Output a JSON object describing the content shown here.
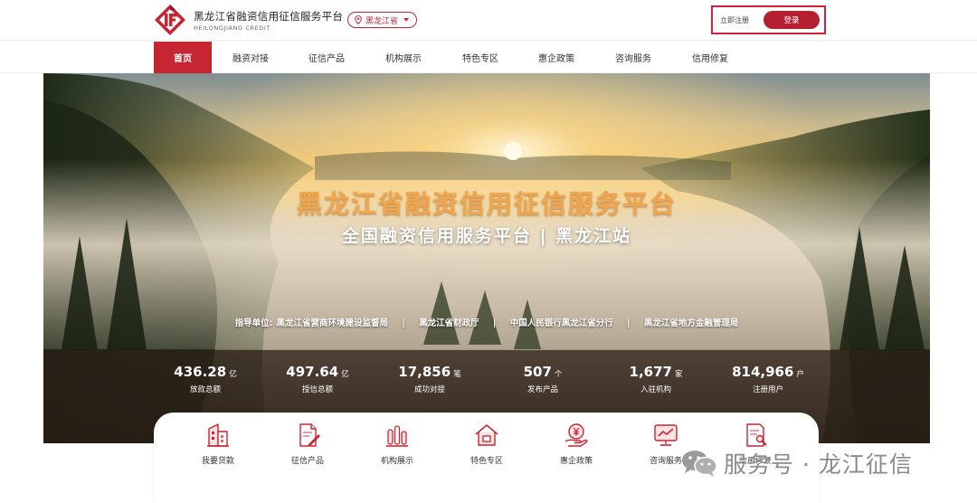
{
  "header": {
    "brand_cn": "黑龙江省融资信用征信服务平台",
    "brand_en": "HEILONGJIANG CREDIT",
    "region": "黑龙江省",
    "register_label": "立即注册",
    "login_label": "登录"
  },
  "nav": {
    "items": [
      {
        "label": "首页",
        "active": true
      },
      {
        "label": "融资对接"
      },
      {
        "label": "征信产品"
      },
      {
        "label": "机构展示"
      },
      {
        "label": "特色专区"
      },
      {
        "label": "惠企政策"
      },
      {
        "label": "咨询服务"
      },
      {
        "label": "信用修复"
      }
    ]
  },
  "hero": {
    "title": "黑龙江省融资信用征信服务平台",
    "subtitle": "全国融资信用服务平台 | 黑龙江站",
    "guidance": {
      "prefix": "指导单位:",
      "units": [
        "黑龙江省营商环境建设监督局",
        "黑龙江省财政厅",
        "中国人民银行黑龙江省分行",
        "黑龙江省地方金融管理局"
      ],
      "separator": "|"
    }
  },
  "stats": [
    {
      "value": "436.28",
      "unit": "亿",
      "label": "放款总额"
    },
    {
      "value": "497.64",
      "unit": "亿",
      "label": "授信总额"
    },
    {
      "value": "17,856",
      "unit": "笔",
      "label": "成功对接"
    },
    {
      "value": "507",
      "unit": "个",
      "label": "发布产品"
    },
    {
      "value": "1,677",
      "unit": "家",
      "label": "入驻机构"
    },
    {
      "value": "814,966",
      "unit": "户",
      "label": "注册用户"
    }
  ],
  "quick_links": [
    {
      "label": "我要贷款",
      "icon": "building-icon"
    },
    {
      "label": "征信产品",
      "icon": "document-pen-icon"
    },
    {
      "label": "机构展示",
      "icon": "bar-chart-icon"
    },
    {
      "label": "特色专区",
      "icon": "house-icon"
    },
    {
      "label": "惠企政策",
      "icon": "yen-hand-icon"
    },
    {
      "label": "咨询服务",
      "icon": "monitor-chart-icon"
    },
    {
      "label": "信用修复",
      "icon": "doc-wrench-icon"
    }
  ],
  "watermark": {
    "text": "服务号 · 龙江征信",
    "icon": "wechat-icon"
  },
  "colors": {
    "brand_red": "#c62532",
    "login_red": "#b4202f",
    "title_gold": "#f1a64d"
  }
}
